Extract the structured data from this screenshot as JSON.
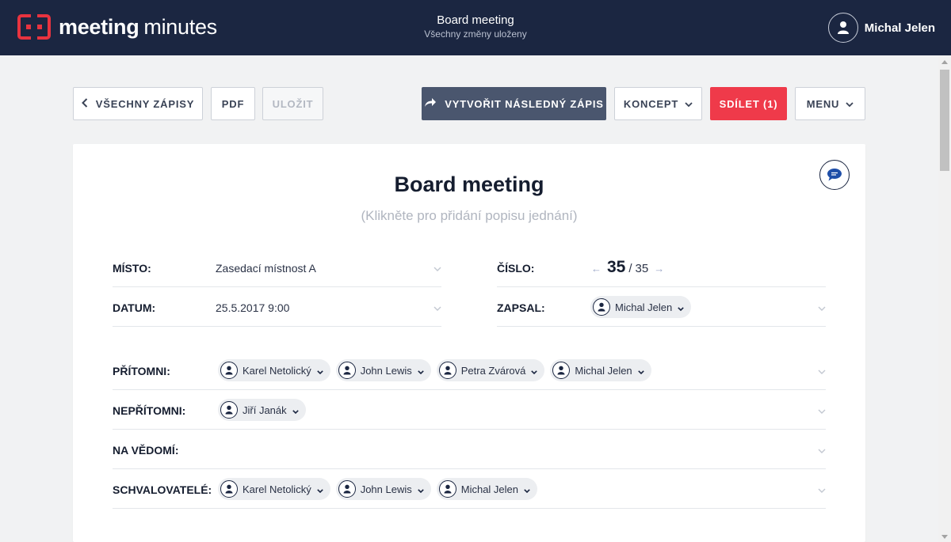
{
  "app": {
    "name_bold": "meeting",
    "name_light": "minutes",
    "brand_color": "#e8333f"
  },
  "header": {
    "doc_title": "Board meeting",
    "save_status": "Všechny změny uloženy",
    "user_name": "Michal Jelen"
  },
  "toolbar": {
    "all_minutes": "VŠECHNY ZÁPISY",
    "pdf": "PDF",
    "save": "ULOŽIT",
    "followup": "VYTVOŘIT NÁSLEDNÝ ZÁPIS",
    "draft": "KONCEPT",
    "share": "SDÍLET (1)",
    "menu": "MENU"
  },
  "meeting": {
    "title": "Board meeting",
    "description_placeholder": "(Klikněte pro přidání popisu jednání)",
    "place_label": "MÍSTO:",
    "place_value": "Zasedací místnost A",
    "date_label": "DATUM:",
    "date_value": "25.5.2017 9:00",
    "number_label": "ČÍSLO:",
    "number_current": "35",
    "number_separator": "/",
    "number_total": "35",
    "recorder_label": "ZAPSAL:",
    "recorder": "Michal Jelen",
    "present_label": "PŘÍTOMNI:",
    "present": [
      "Karel Netolický",
      "John Lewis",
      "Petra Zvárová",
      "Michal Jelen"
    ],
    "absent_label": "NEPŘÍTOMNI:",
    "absent": [
      "Jiří Janák"
    ],
    "informed_label": "NA VĚDOMÍ:",
    "informed": [],
    "approvers_label": "SCHVALOVATELÉ:",
    "approvers": [
      "Karel Netolický",
      "John Lewis",
      "Michal Jelen"
    ]
  },
  "colors": {
    "topbar": "#1b2641",
    "share_button": "#ef3a4a",
    "followup_button": "#4a566e"
  }
}
